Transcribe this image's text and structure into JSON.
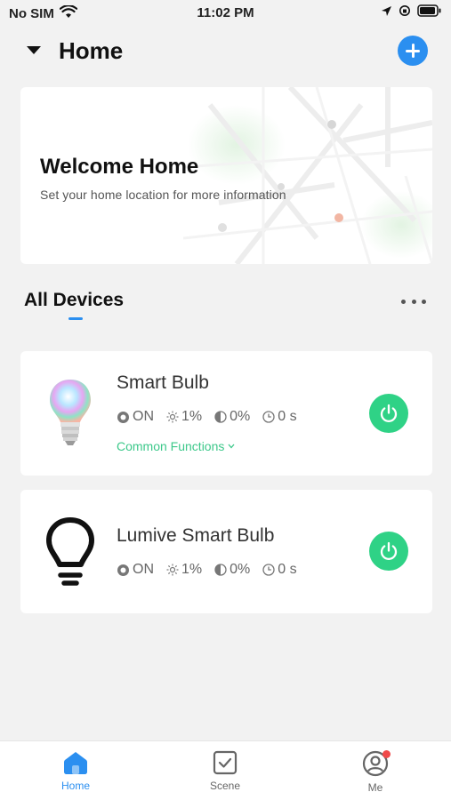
{
  "status_bar": {
    "carrier": "No SIM",
    "time": "11:02 PM"
  },
  "header": {
    "title": "Home"
  },
  "welcome": {
    "title": "Welcome Home",
    "subtitle": "Set your home location for more information"
  },
  "devices_section": {
    "title": "All Devices"
  },
  "devices": [
    {
      "name": "Smart Bulb",
      "icon": "rgb-bulb-icon",
      "power_state": "ON",
      "brightness": "1%",
      "contrast": "0%",
      "timer": "0 s",
      "functions_label": "Common Functions"
    },
    {
      "name": "Lumive Smart Bulb",
      "icon": "lightbulb-outline-icon",
      "power_state": "ON",
      "brightness": "1%",
      "contrast": "0%",
      "timer": "0 s"
    }
  ],
  "tab_bar": {
    "items": [
      {
        "label": "Home",
        "icon": "home-icon",
        "active": true
      },
      {
        "label": "Scene",
        "icon": "scene-checkbox-icon",
        "active": false
      },
      {
        "label": "Me",
        "icon": "user-icon",
        "active": false,
        "badge": true
      }
    ]
  },
  "colors": {
    "accent_blue": "#2b8ff0",
    "power_green": "#2fd286",
    "link_green": "#3cc88a",
    "badge_red": "#f04a4a",
    "background": "#f2f2f2"
  }
}
